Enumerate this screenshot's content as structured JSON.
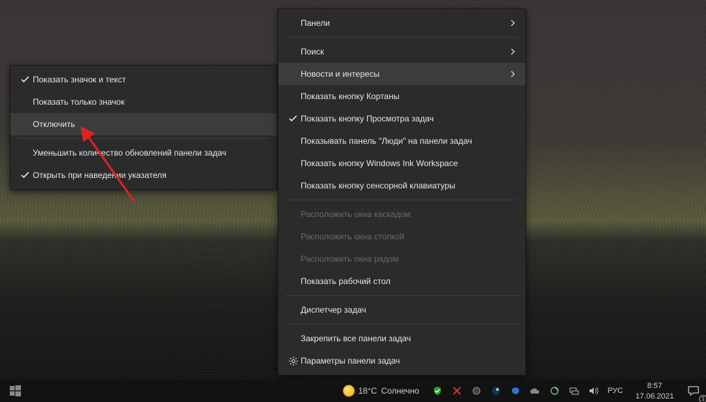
{
  "submenu": {
    "items": [
      {
        "type": "item",
        "label": "Показать значок и текст",
        "checked": true
      },
      {
        "type": "item",
        "label": "Показать только значок",
        "checked": false
      },
      {
        "type": "item",
        "label": "Отключить",
        "checked": false,
        "hover": true
      },
      {
        "type": "sep"
      },
      {
        "type": "item",
        "label": "Уменьшить количество обновлений панели задач",
        "checked": false
      },
      {
        "type": "item",
        "label": "Открыть при наведении указателя",
        "checked": true
      }
    ]
  },
  "main_menu": {
    "items": [
      {
        "type": "item",
        "label": "Панели",
        "arrow": true
      },
      {
        "type": "sep"
      },
      {
        "type": "item",
        "label": "Поиск",
        "arrow": true
      },
      {
        "type": "item",
        "label": "Новости и интересы",
        "arrow": true,
        "hover": true
      },
      {
        "type": "item",
        "label": "Показать кнопку Кортаны"
      },
      {
        "type": "item",
        "label": "Показать кнопку Просмотра задач",
        "checked": true
      },
      {
        "type": "item",
        "label": "Показывать панель \"Люди\" на панели задач"
      },
      {
        "type": "item",
        "label": "Показать кнопку Windows Ink Workspace"
      },
      {
        "type": "item",
        "label": "Показать кнопку сенсорной клавиатуры"
      },
      {
        "type": "sep"
      },
      {
        "type": "item",
        "label": "Расположить окна каскадом",
        "disabled": true
      },
      {
        "type": "item",
        "label": "Расположить окна стопкой",
        "disabled": true
      },
      {
        "type": "item",
        "label": "Расположить окна рядом",
        "disabled": true
      },
      {
        "type": "item",
        "label": "Показать рабочий стол"
      },
      {
        "type": "sep"
      },
      {
        "type": "item",
        "label": "Диспетчер задач"
      },
      {
        "type": "sep"
      },
      {
        "type": "item",
        "label": "Закрепить все панели задач"
      },
      {
        "type": "item",
        "label": "Параметры панели задач",
        "gear": true
      }
    ]
  },
  "taskbar": {
    "weather_value": "18°C",
    "weather_label": "Солнечно",
    "lang": "РУС",
    "time": "8:57",
    "date": "17.06.2021",
    "notif_count": "1"
  }
}
